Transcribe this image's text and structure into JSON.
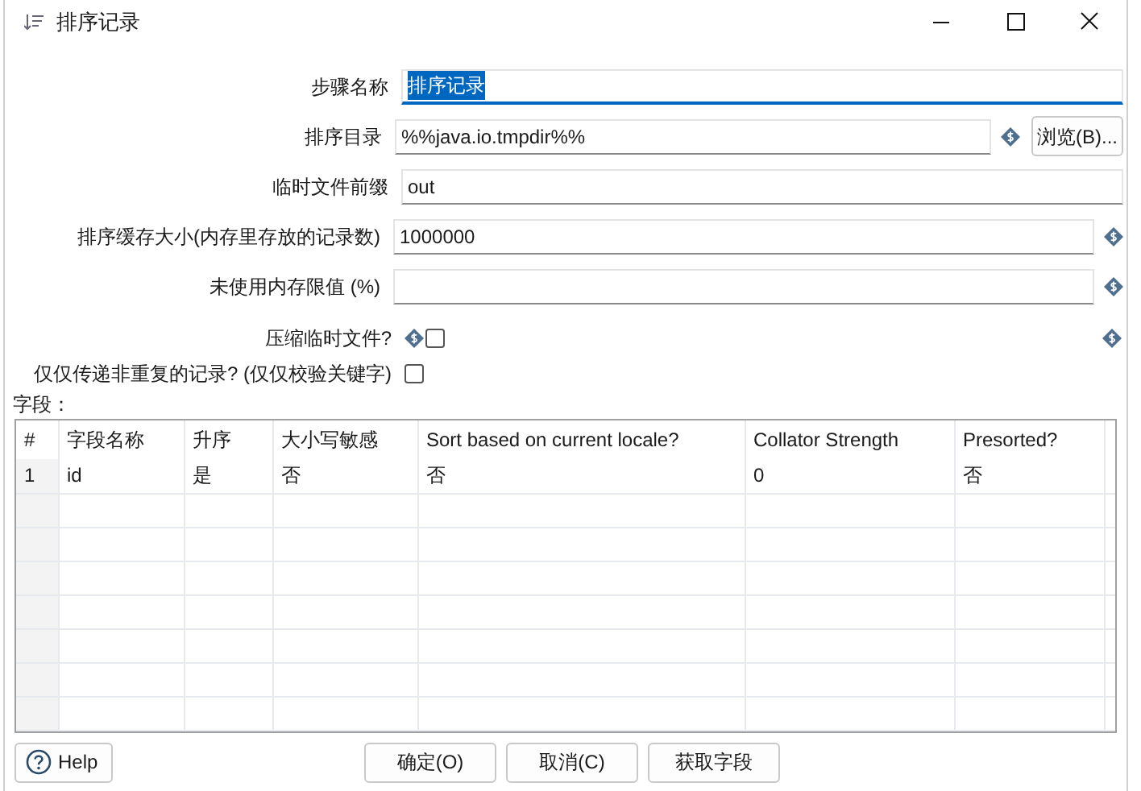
{
  "window": {
    "title": "排序记录"
  },
  "form": [
    {
      "kind": "text",
      "label": "步骤名称",
      "value": "排序记录",
      "focused": true,
      "variable": false
    },
    {
      "kind": "browse",
      "label": "排序目录",
      "value": "%%java.io.tmpdir%%",
      "focused": false,
      "variable": true,
      "button": "浏览(B)..."
    },
    {
      "kind": "text",
      "label": "临时文件前缀",
      "value": "out",
      "focused": false,
      "variable": false
    },
    {
      "kind": "text",
      "label": "排序缓存大小(内存里存放的记录数)",
      "value": "1000000",
      "focused": false,
      "variable": true
    },
    {
      "kind": "text",
      "label": "未使用内存限值 (%)",
      "focused": false,
      "variable": true
    },
    {
      "kind": "checkbox",
      "label": "压缩临时文件?",
      "checked": false,
      "variable": true
    },
    {
      "kind": "checkbox",
      "label": "仅仅传递非重复的记录? (仅仅校验关键字)",
      "checked": false,
      "variable": false
    }
  ],
  "fields_label": "字段：",
  "table": {
    "columns": [
      "#",
      "字段名称",
      "升序",
      "大小写敏感",
      "Sort based on current locale?",
      "Collator Strength",
      "Presorted?"
    ],
    "rows": [
      [
        "1",
        "id",
        "是",
        "否",
        "否",
        "0",
        "否"
      ]
    ]
  },
  "buttons": {
    "help": "Help",
    "actions": [
      "确定(O)",
      "取消(C)",
      "获取字段"
    ]
  }
}
